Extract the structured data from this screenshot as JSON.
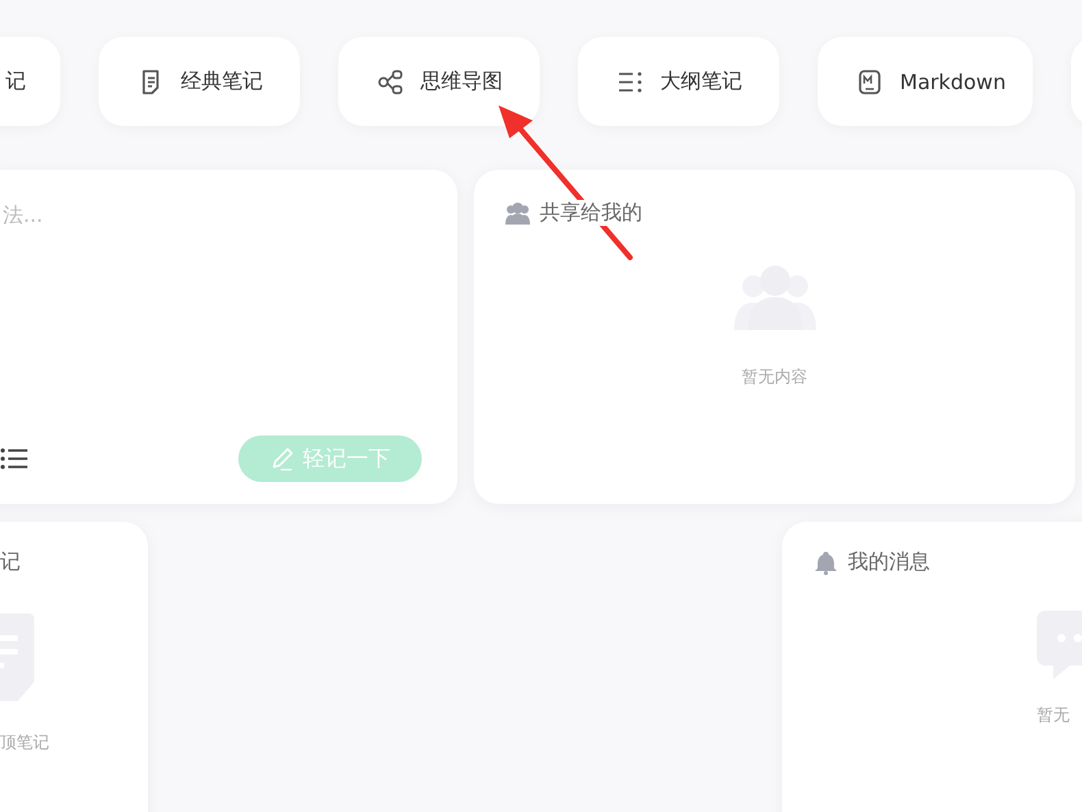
{
  "note_types": [
    {
      "kind": "chip",
      "label": "记"
    },
    {
      "kind": "chip",
      "label": "经典笔记"
    },
    {
      "kind": "chip",
      "label": "思维导图"
    },
    {
      "kind": "chip",
      "label": "大纲笔记"
    },
    {
      "kind": "chip",
      "label": "Markdown"
    },
    {
      "kind": "edge"
    }
  ],
  "quick_note": {
    "placeholder": "法...",
    "button": {
      "label": "轻记一下",
      "disabled": true
    }
  },
  "shared": {
    "title": "共享给我的",
    "empty_text": "暂无内容"
  },
  "pinned": {
    "title": "记",
    "empty_text": "顶笔记"
  },
  "messages": {
    "title": "我的消息",
    "empty_text": "暂无"
  },
  "annotation_arrow": {
    "kind": "arrow"
  }
}
